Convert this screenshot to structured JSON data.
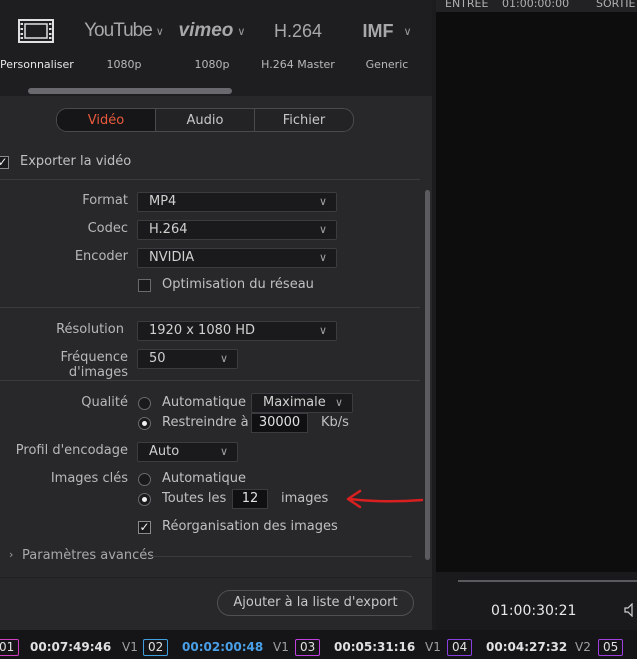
{
  "presets": [
    {
      "name": "Personnaliser",
      "icon": "film-icon",
      "active": true
    },
    {
      "name": "1080p",
      "brand": "YouTube"
    },
    {
      "name": "1080p",
      "brand": "vimeo"
    },
    {
      "name": "H.264 Master",
      "brand": "H.264"
    },
    {
      "name": "Generic",
      "brand": "IMF"
    }
  ],
  "tabs": [
    "Vidéo",
    "Audio",
    "Fichier"
  ],
  "export_video_label": "Exporter la vidéo",
  "format": {
    "label": "Format",
    "value": "MP4"
  },
  "codec": {
    "label": "Codec",
    "value": "H.264"
  },
  "encoder": {
    "label": "Encoder",
    "value": "NVIDIA"
  },
  "network_opt": "Optimisation du réseau",
  "resolution": {
    "label": "Résolution",
    "value": "1920 x 1080 HD"
  },
  "framerate": {
    "label": "Fréquence d'images",
    "value": "50"
  },
  "quality": {
    "label": "Qualité",
    "auto": "Automatique",
    "auto_value": "Maximale",
    "restrict": "Restreindre à",
    "restrict_value": "30000",
    "unit": "Kb/s"
  },
  "encoding_profile": {
    "label": "Profil d'encodage",
    "value": "Auto"
  },
  "keyframes": {
    "label": "Images clés",
    "auto": "Automatique",
    "every": "Toutes les",
    "every_value": "12",
    "every_unit": "images"
  },
  "reorder": "Réorganisation des images",
  "advanced": "Paramètres avancés",
  "add_button": "Ajouter à la liste d'export",
  "viewer": {
    "in_label": "ENTRÉE",
    "in_tc": "01:00:00:00",
    "out_label": "SORTIE",
    "timecode": "01:00:30:21"
  },
  "timeline": [
    {
      "badge": "01",
      "tc": "00:07:49:46",
      "color": "#d040c0"
    },
    {
      "track": "V1",
      "badge": "02",
      "tc": "00:02:00:48",
      "color": "#40a0e0",
      "tc_color": "#4aa0e8"
    },
    {
      "track": "V1",
      "badge": "03",
      "tc": "00:05:31:16",
      "color": "#c040e0"
    },
    {
      "track": "V1",
      "badge": "04",
      "tc": "00:04:27:32",
      "color": "#8a40e0"
    },
    {
      "track": "V2",
      "badge": "05",
      "tc": "",
      "color": "#a040e0"
    }
  ],
  "colors": {
    "accent": "#e85a3c",
    "annotation_arrow": "#d82020"
  }
}
